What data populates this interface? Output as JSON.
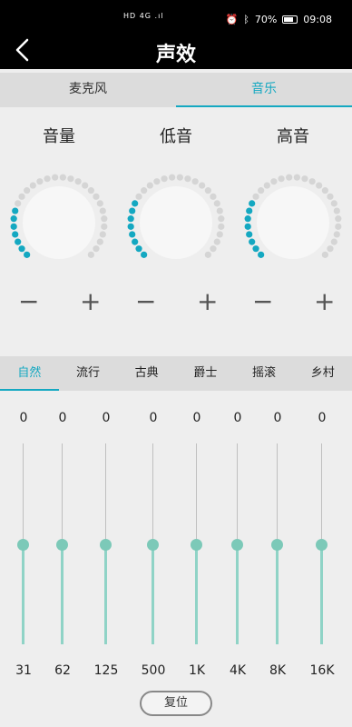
{
  "status_bar": {
    "signal_text": "HD 4G .ıl",
    "battery_percent": "70%",
    "time": "09:08"
  },
  "header": {
    "title": "声效"
  },
  "source_tabs": [
    {
      "label": "麦克风",
      "active": false
    },
    {
      "label": "音乐",
      "active": true
    }
  ],
  "knobs": [
    {
      "label": "音量",
      "level": 0.25
    },
    {
      "label": "低音",
      "level": 0.3
    },
    {
      "label": "高音",
      "level": 0.28
    }
  ],
  "controls": {
    "minus": "−",
    "plus": "+"
  },
  "presets": [
    {
      "label": "自然",
      "active": true
    },
    {
      "label": "流行",
      "active": false
    },
    {
      "label": "古典",
      "active": false
    },
    {
      "label": "爵士",
      "active": false
    },
    {
      "label": "摇滚",
      "active": false
    },
    {
      "label": "乡村",
      "active": false
    }
  ],
  "eq_bands": [
    {
      "freq": "31",
      "value": "0",
      "level": 0.5
    },
    {
      "freq": "62",
      "value": "0",
      "level": 0.5
    },
    {
      "freq": "125",
      "value": "0",
      "level": 0.5
    },
    {
      "freq": "500",
      "value": "0",
      "level": 0.5
    },
    {
      "freq": "1K",
      "value": "0",
      "level": 0.5
    },
    {
      "freq": "4K",
      "value": "0",
      "level": 0.5
    },
    {
      "freq": "8K",
      "value": "0",
      "level": 0.5
    },
    {
      "freq": "16K",
      "value": "0",
      "level": 0.5
    }
  ],
  "reset_label": "复位",
  "colors": {
    "accent": "#14a8c1",
    "slider": "#7cc9b8",
    "dot_inactive": "#d5d5d5"
  }
}
